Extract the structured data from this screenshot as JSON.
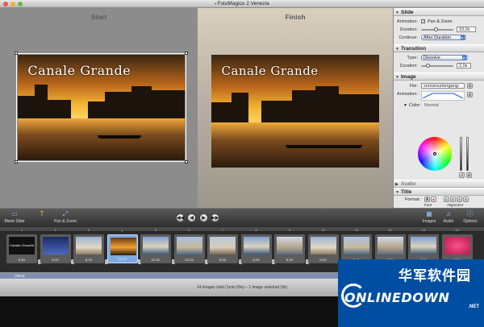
{
  "window": {
    "title": "FotoMagico 2 Venezia"
  },
  "preview": {
    "start_label": "Start",
    "finish_label": "Finish",
    "slide_title": "Canale Grande"
  },
  "inspector": {
    "slide": {
      "header": "Slide",
      "animation_label": "Animation:",
      "pan_zoom_label": "Pan & Zoom",
      "pan_zoom_checked": true,
      "duration_label": "Duration:",
      "duration_value": "10,0s",
      "continue_label": "Continue:",
      "continue_value": "After Duration"
    },
    "transition": {
      "header": "Transition",
      "type_label": "Type:",
      "type_value": "Dissolve",
      "duration_label": "Duration:",
      "duration_value": "2,0s"
    },
    "image": {
      "header": "Image",
      "file_label": "File:",
      "file_value": "sonnenuntergang-",
      "animation_label": "Animation:",
      "color_label": "Color:",
      "color_value": "Normal"
    },
    "audio": {
      "header": "Audio"
    },
    "title": {
      "header": "Title",
      "format_label": "Format:",
      "font_label": "Font",
      "alignment_label": "Alignment"
    }
  },
  "toolbar": {
    "blank_slide": "Blank Slide",
    "pan_zoom": "Pan & Zoom",
    "images": "Images",
    "audio": "Audio",
    "options": "Options"
  },
  "timeline": {
    "slides": [
      {
        "num": "1",
        "dur": "6,0s",
        "kind": "title"
      },
      {
        "num": "2",
        "dur": "8,0s",
        "kind": "night"
      },
      {
        "num": "3",
        "dur": "8,0s",
        "kind": "building"
      },
      {
        "num": "4",
        "dur": "10,0s",
        "kind": "sunset",
        "selected": true
      },
      {
        "num": "5",
        "dur": "10,0s",
        "kind": "canal"
      },
      {
        "num": "6",
        "dur": "12,0s",
        "kind": "canal2"
      },
      {
        "num": "7",
        "dur": "8,0s",
        "kind": "square"
      },
      {
        "num": "8",
        "dur": "8,0s",
        "kind": "canal"
      },
      {
        "num": "9",
        "dur": "8,0s",
        "kind": "bridge"
      },
      {
        "num": "10",
        "dur": "8,0s",
        "kind": "building"
      },
      {
        "num": "11",
        "dur": "8,0s",
        "kind": "canal2"
      },
      {
        "num": "12",
        "dur": "8,0s",
        "kind": "bridge"
      },
      {
        "num": "13",
        "dur": "8,0s",
        "kind": "canal"
      },
      {
        "num": "14",
        "dur": "8,0s",
        "kind": "flowers"
      }
    ],
    "audio_label": "(Tanz)"
  },
  "status": {
    "summary": "14 images total (1min 59s) – 1 image selected (9s)"
  },
  "watermark": {
    "cn_text": "华军软件园",
    "brand": "ONLINEDOWN",
    "suffix": ".NET"
  },
  "colors": {
    "accent": "#4a7ad8",
    "selection": "#7ea9e0",
    "watermark_bg": "#004ea2"
  }
}
